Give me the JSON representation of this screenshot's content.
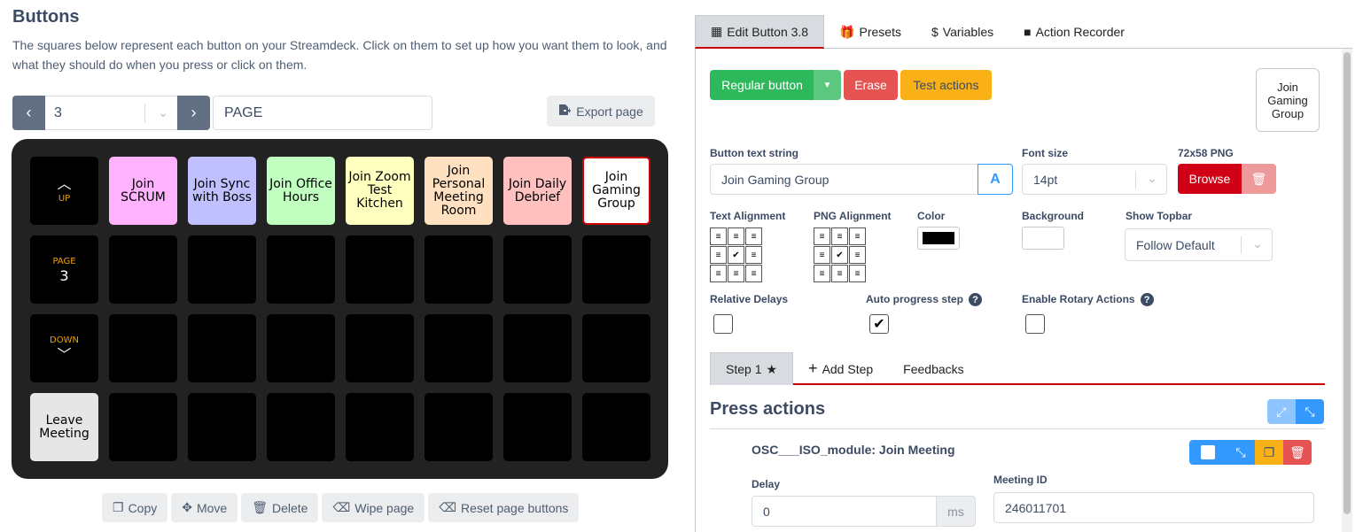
{
  "left": {
    "title": "Buttons",
    "description": "The squares below represent each button on your Streamdeck. Click on them to set up how you want them to look, and what they should do when you press or click on them.",
    "page_number": "3",
    "page_name": "PAGE",
    "export_label": "Export page",
    "nav_up": "UP",
    "nav_page_label": "PAGE",
    "nav_page_value": "3",
    "nav_down": "DOWN",
    "keys": [
      {
        "text": "Join SCRUM",
        "bg": "#ffb3ff"
      },
      {
        "text": "Join Sync with Boss",
        "bg": "#c0c0ff"
      },
      {
        "text": "Join Office Hours",
        "bg": "#c0ffc0"
      },
      {
        "text": "Join Zoom Test Kitchen",
        "bg": "#ffffc0"
      },
      {
        "text": "Join Personal Meeting Room",
        "bg": "#ffe0c0"
      },
      {
        "text": "Join Daily Debrief",
        "bg": "#ffc0c0"
      },
      {
        "text": "Join Gaming Group",
        "bg": "#ffffff"
      }
    ],
    "leave_meeting": "Leave Meeting",
    "bottom_buttons": [
      "Copy",
      "Move",
      "Delete",
      "Wipe page",
      "Reset page buttons"
    ]
  },
  "right": {
    "tabs": [
      "Edit Button 3.8",
      "Presets",
      "Variables",
      "Action Recorder"
    ],
    "regular_button": "Regular button",
    "erase": "Erase",
    "test_actions": "Test actions",
    "preview_text": "Join Gaming Group",
    "button_text_label": "Button text string",
    "button_text_value": "Join Gaming Group",
    "font_size_label": "Font size",
    "font_size_value": "14pt",
    "png_label": "72x58 PNG",
    "browse": "Browse",
    "text_alignment_label": "Text Alignment",
    "png_alignment_label": "PNG Alignment",
    "color_label": "Color",
    "background_label": "Background",
    "show_topbar_label": "Show Topbar",
    "show_topbar_value": "Follow Default",
    "relative_delays_label": "Relative Delays",
    "auto_progress_label": "Auto progress step",
    "enable_rotary_label": "Enable Rotary Actions",
    "step_tabs": [
      "Step 1",
      "Add Step",
      "Feedbacks"
    ],
    "press_actions_title": "Press actions",
    "action_name": "OSC___ISO_module: Join Meeting",
    "delay_label": "Delay",
    "delay_value": "0",
    "delay_unit": "ms",
    "meeting_id_label": "Meeting ID",
    "meeting_id_value": "246011701"
  },
  "colors": {
    "accent_red": "#c00000",
    "green": "#2eb85c",
    "erase_red": "#e55353",
    "warning": "#f9b115",
    "info_blue": "#39f"
  }
}
